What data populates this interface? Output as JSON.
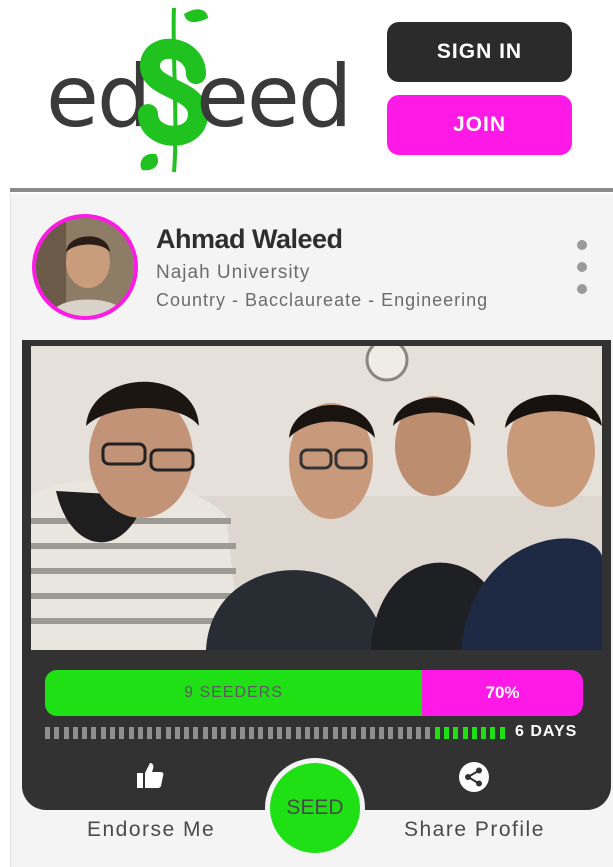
{
  "header": {
    "logo": {
      "text_left": "ed",
      "text_right": "eed",
      "brand_colors": {
        "text": "#3a3a3a",
        "leaf": "#1fc21f"
      }
    },
    "sign_in_label": "SIGN IN",
    "join_label": "JOIN"
  },
  "profile": {
    "name": "Ahmad Waleed",
    "university": "Najah University",
    "details": "Country - Bacclaureate - Engineering",
    "avatar_ring_color": "#ff19e6"
  },
  "campaign": {
    "seeders_label": "9 SEEDERS",
    "percent_label": "70%",
    "progress_fraction": 0.7,
    "days_label": "6 DAYS",
    "days_total_segments": 50,
    "days_remaining_segments": 8,
    "colors": {
      "progress": "#1ee014",
      "remaining": "#ff19e6",
      "panel": "#323232"
    }
  },
  "actions": {
    "endorse_icon": "thumbs-up-icon",
    "endorse_label": "Endorse Me",
    "seed_label": "SEED",
    "share_icon": "share-icon",
    "share_label": "Share Profile"
  }
}
